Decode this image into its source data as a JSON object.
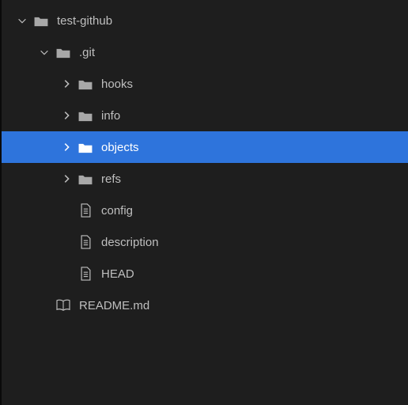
{
  "tree": {
    "root": {
      "label": "test-github"
    },
    "git": {
      "label": ".git"
    },
    "hooks": {
      "label": "hooks"
    },
    "info": {
      "label": "info"
    },
    "objects": {
      "label": "objects"
    },
    "refs": {
      "label": "refs"
    },
    "config": {
      "label": "config"
    },
    "description": {
      "label": "description"
    },
    "head": {
      "label": "HEAD"
    },
    "readme": {
      "label": "README.md"
    }
  },
  "colors": {
    "selection": "#2e74dc",
    "background": "#1e1e1e",
    "text": "#bfbfbf",
    "folder": "#a8a8a8"
  }
}
